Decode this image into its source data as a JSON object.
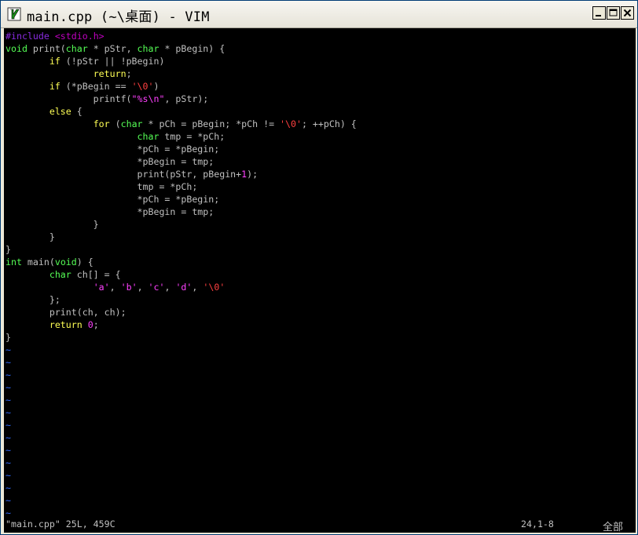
{
  "window": {
    "title": "main.cpp (~\\桌面) - VIM"
  },
  "editor": {
    "lines": [
      [
        [
          "#include ",
          "kw-pre"
        ],
        [
          "<stdio.h>",
          "kw-inc"
        ]
      ],
      [
        [
          "void",
          "ty"
        ],
        [
          " print(",
          ""
        ],
        [
          "char",
          "ty"
        ],
        [
          " * pStr, ",
          ""
        ],
        [
          "char",
          "ty"
        ],
        [
          " * pBegin) {",
          ""
        ]
      ],
      [
        [
          "        ",
          ""
        ],
        [
          "if",
          "kw"
        ],
        [
          " (!pStr || !pBegin)",
          ""
        ]
      ],
      [
        [
          "                ",
          ""
        ],
        [
          "return",
          "kw"
        ],
        [
          ";",
          ""
        ]
      ],
      [
        [
          "        ",
          ""
        ],
        [
          "if",
          "kw"
        ],
        [
          " (*pBegin == ",
          ""
        ],
        [
          "'\\0'",
          "sp"
        ],
        [
          ")",
          ""
        ]
      ],
      [
        [
          "                printf(",
          ""
        ],
        [
          "\"%s\\n\"",
          "st"
        ],
        [
          ", pStr);",
          ""
        ]
      ],
      [
        [
          "        ",
          ""
        ],
        [
          "else",
          "kw"
        ],
        [
          " {",
          ""
        ]
      ],
      [
        [
          "                ",
          ""
        ],
        [
          "for",
          "kw"
        ],
        [
          " (",
          ""
        ],
        [
          "char",
          "ty"
        ],
        [
          " * pCh = pBegin; *pCh != ",
          ""
        ],
        [
          "'\\0'",
          "sp"
        ],
        [
          "; ++pCh) {",
          ""
        ]
      ],
      [
        [
          "                        ",
          ""
        ],
        [
          "char",
          "ty"
        ],
        [
          " tmp = *pCh;",
          ""
        ]
      ],
      [
        [
          "                        *pCh = *pBegin;",
          ""
        ]
      ],
      [
        [
          "                        *pBegin = tmp;",
          ""
        ]
      ],
      [
        [
          "                        print(pStr, pBegin+",
          ""
        ],
        [
          "1",
          "num"
        ],
        [
          ");",
          ""
        ]
      ],
      [
        [
          "                        tmp = *pCh;",
          ""
        ]
      ],
      [
        [
          "                        *pCh = *pBegin;",
          ""
        ]
      ],
      [
        [
          "                        *pBegin = tmp;",
          ""
        ]
      ],
      [
        [
          "                }",
          ""
        ]
      ],
      [
        [
          "        }",
          ""
        ]
      ],
      [
        [
          "}",
          ""
        ]
      ],
      [
        [
          "int",
          "ty"
        ],
        [
          " main(",
          ""
        ],
        [
          "void",
          "ty"
        ],
        [
          ") {",
          ""
        ]
      ],
      [
        [
          "        ",
          ""
        ],
        [
          "char",
          "ty"
        ],
        [
          " ch[] = {",
          ""
        ]
      ],
      [
        [
          "                ",
          ""
        ],
        [
          "'a'",
          "st"
        ],
        [
          ", ",
          ""
        ],
        [
          "'b'",
          "st"
        ],
        [
          ", ",
          ""
        ],
        [
          "'c'",
          "st"
        ],
        [
          ", ",
          ""
        ],
        [
          "'d'",
          "st"
        ],
        [
          ", ",
          ""
        ],
        [
          "'\\0'",
          "sp"
        ]
      ],
      [
        [
          "        };",
          ""
        ]
      ],
      [
        [
          "        print(ch, ch);",
          ""
        ]
      ],
      [
        [
          "        ",
          ""
        ],
        [
          "return",
          "kw"
        ],
        [
          " ",
          ""
        ],
        [
          "0",
          "num"
        ],
        [
          ";",
          ""
        ]
      ],
      [
        [
          "}",
          ""
        ]
      ]
    ],
    "empty_marker": "~",
    "empty_lines": 14
  },
  "status": {
    "file_info": "\"main.cpp\" 25L, 459C",
    "cursor_pos": "24,1-8",
    "scroll": "全部"
  },
  "colors": {
    "keyword": "#ffff55",
    "type": "#55ff55",
    "string": "#ff40ff",
    "special": "#ff4040",
    "preproc": "#8a2be2",
    "tilde": "#2f6bff"
  }
}
